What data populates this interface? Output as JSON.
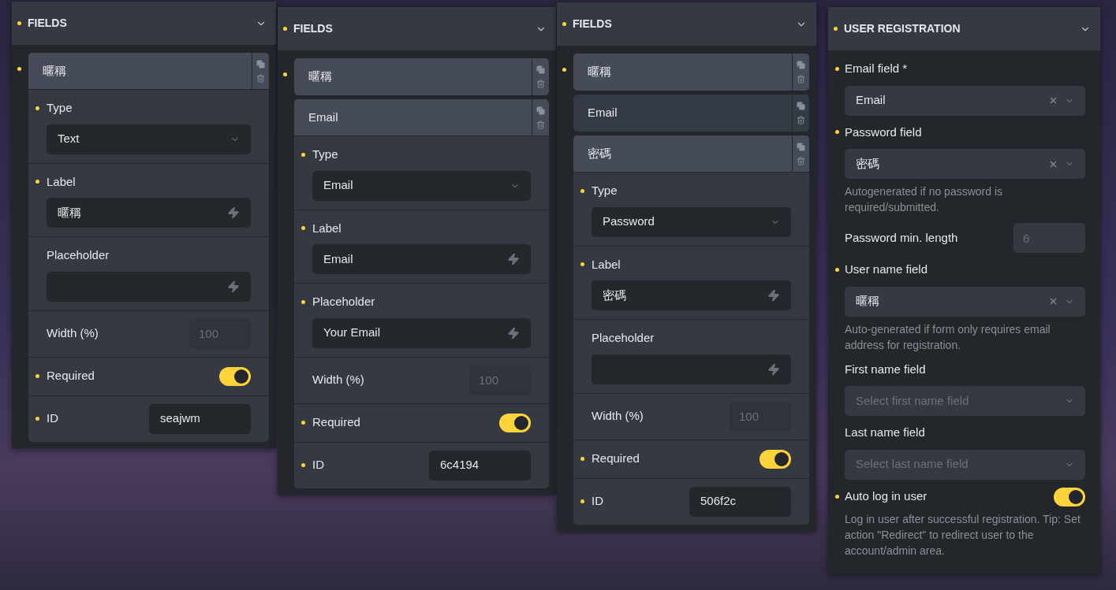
{
  "panels": [
    {
      "kind": "fields",
      "title": "FIELDS",
      "modified": true,
      "items_modified": true,
      "items": [
        {
          "label": "暱稱",
          "active": true,
          "expanded": true,
          "settings": [
            {
              "kind": "select",
              "label": "Type",
              "modified": true,
              "value": "Text"
            },
            {
              "kind": "text",
              "label": "Label",
              "modified": true,
              "value": "暱稱"
            },
            {
              "kind": "text",
              "label": "Placeholder",
              "modified": false
            },
            {
              "kind": "number",
              "label": "Width (%)",
              "modified": false,
              "placeholder": "100"
            },
            {
              "kind": "toggle",
              "label": "Required",
              "modified": true,
              "on": true
            },
            {
              "kind": "id",
              "label": "ID",
              "modified": true,
              "value": "seajwm"
            }
          ]
        }
      ]
    },
    {
      "kind": "fields",
      "title": "FIELDS",
      "modified": true,
      "items_modified": true,
      "items": [
        {
          "label": "暱稱",
          "active": true,
          "expanded": false
        },
        {
          "label": "Email",
          "active": true,
          "expanded": true,
          "settings": [
            {
              "kind": "select",
              "label": "Type",
              "modified": true,
              "value": "Email"
            },
            {
              "kind": "text",
              "label": "Label",
              "modified": true,
              "value": "Email"
            },
            {
              "kind": "text",
              "label": "Placeholder",
              "modified": true,
              "value": "Your Email"
            },
            {
              "kind": "number",
              "label": "Width (%)",
              "modified": false,
              "placeholder": "100"
            },
            {
              "kind": "toggle",
              "label": "Required",
              "modified": true,
              "on": true
            },
            {
              "kind": "id",
              "label": "ID",
              "modified": true,
              "value": "6c4194"
            }
          ]
        }
      ]
    },
    {
      "kind": "fields",
      "title": "FIELDS",
      "modified": true,
      "items_modified": true,
      "items": [
        {
          "label": "暱稱",
          "active": true,
          "expanded": false
        },
        {
          "label": "Email",
          "active": false,
          "expanded": false
        },
        {
          "label": "密碼",
          "active": true,
          "expanded": true,
          "settings": [
            {
              "kind": "select",
              "label": "Type",
              "modified": true,
              "value": "Password"
            },
            {
              "kind": "text",
              "label": "Label",
              "modified": true,
              "value": "密碼"
            },
            {
              "kind": "text",
              "label": "Placeholder",
              "modified": false
            },
            {
              "kind": "number",
              "label": "Width (%)",
              "modified": false,
              "placeholder": "100"
            },
            {
              "kind": "toggle",
              "label": "Required",
              "modified": true,
              "on": true
            },
            {
              "kind": "id",
              "label": "ID",
              "modified": true,
              "value": "506f2c"
            }
          ]
        }
      ]
    },
    {
      "kind": "registration",
      "title": "USER REGISTRATION",
      "modified": true,
      "settings": [
        {
          "kind": "select",
          "label": "Email field *",
          "modified": true,
          "value": "Email",
          "clearable": true
        },
        {
          "kind": "select",
          "label": "Password field",
          "modified": true,
          "value": "密碼",
          "clearable": true,
          "description": "Autogenerated if no password is required/submitted."
        },
        {
          "kind": "number",
          "label": "Password min. length",
          "modified": false,
          "placeholder": "6"
        },
        {
          "kind": "select",
          "label": "User name field",
          "modified": true,
          "value": "暱稱",
          "clearable": true,
          "description": "Auto-generated if form only requires email address for registration."
        },
        {
          "kind": "select",
          "label": "First name field",
          "modified": false,
          "placeholder": "Select first name field"
        },
        {
          "kind": "select",
          "label": "Last name field",
          "modified": false,
          "placeholder": "Select last name field"
        },
        {
          "kind": "toggle",
          "label": "Auto log in user",
          "modified": true,
          "on": true,
          "description": "Log in user after successful registration. Tip: Set action \"Redirect\" to redirect user to the account/admin area."
        }
      ]
    }
  ]
}
